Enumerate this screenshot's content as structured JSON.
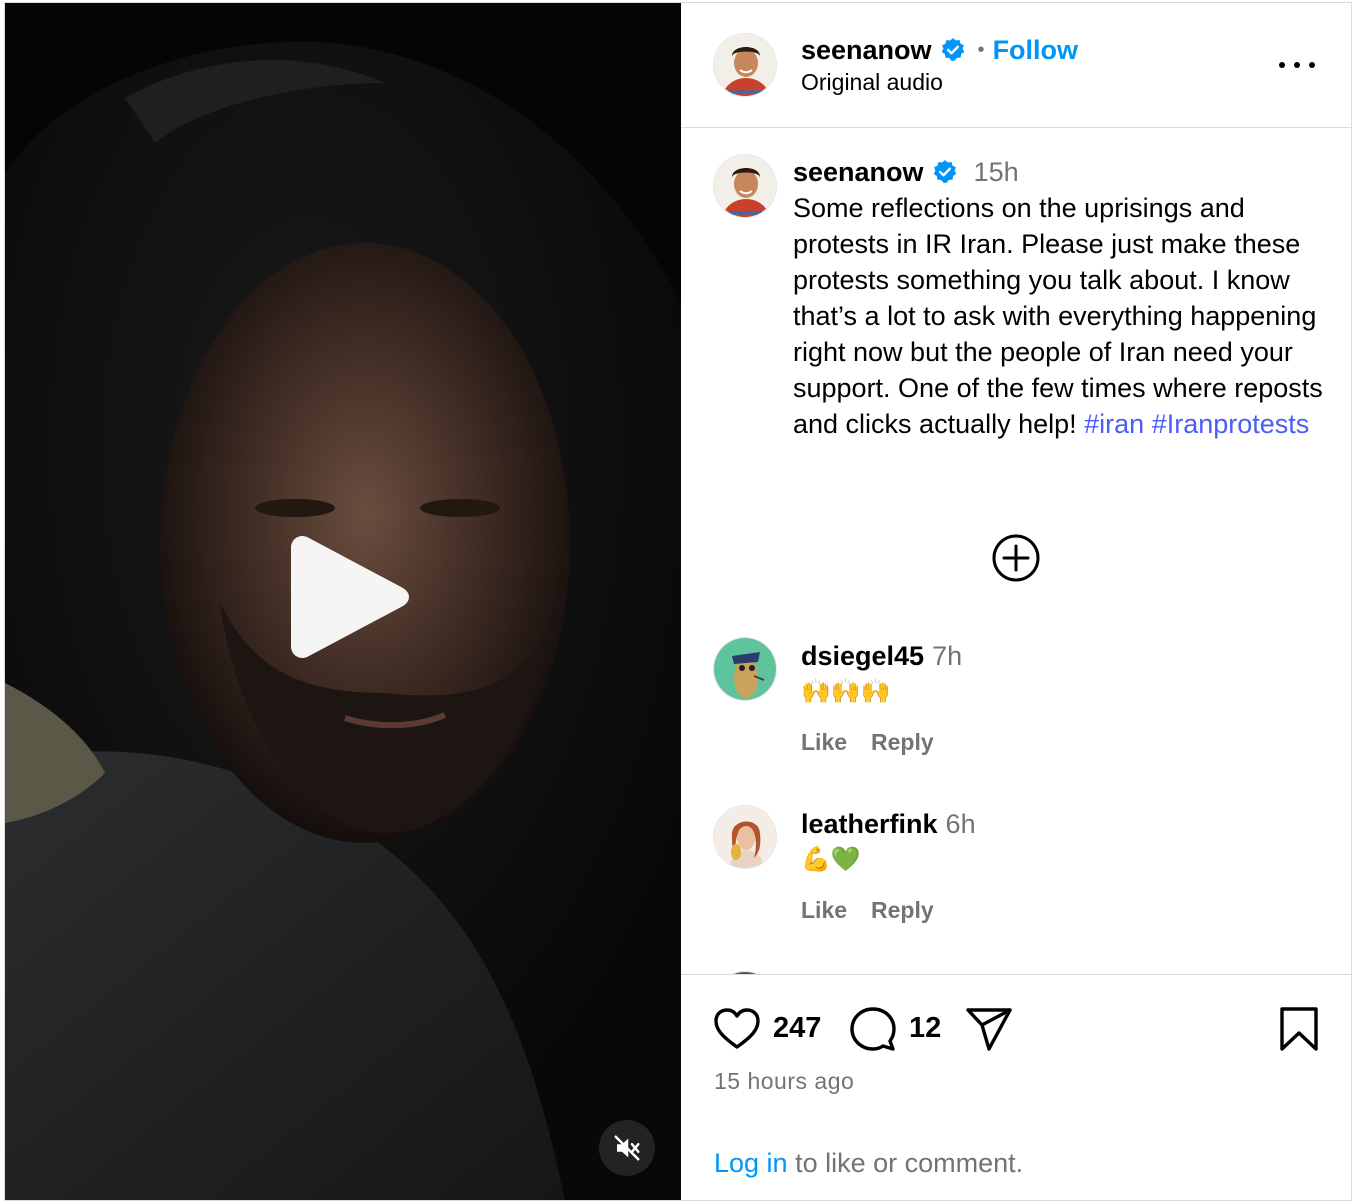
{
  "header": {
    "username": "seenanow",
    "follow_label": "Follow",
    "audio_label": "Original audio",
    "separator": "•"
  },
  "caption": {
    "username": "seenanow",
    "time": "15h",
    "text": "Some reflections on the uprisings and protests in IR Iran. Please just make these protests something you talk about. I know that’s a lot to ask with everything happening right now but the people of Iran need your support. One of the few times where reposts and clicks actually help! ",
    "hashtags": [
      "#iran",
      "#Iranprotests"
    ]
  },
  "comments": [
    {
      "username": "dsiegel45",
      "time": "7h",
      "body": "🙌🙌🙌",
      "like_label": "Like",
      "reply_label": "Reply"
    },
    {
      "username": "leatherfink",
      "time": "6h",
      "body": "💪💚",
      "like_label": "Like",
      "reply_label": "Reply"
    }
  ],
  "stats": {
    "likes": "247",
    "comments": "12",
    "posted": "15 hours ago"
  },
  "login": {
    "link_label": "Log in",
    "rest": " to like or comment."
  },
  "icons": {
    "play": "play-icon",
    "mute": "muted-speaker-icon",
    "verified": "verified-badge-icon",
    "more": "more-options-icon",
    "add": "plus-circle-icon",
    "like": "heart-icon",
    "comment": "speech-bubble-icon",
    "share": "paper-plane-icon",
    "save": "bookmark-icon"
  },
  "colors": {
    "accent": "#0095f6",
    "hashtag": "#4a5df9",
    "verified": "#0095f6",
    "secondary_text": "#737373",
    "divider": "#dbdbdb"
  }
}
